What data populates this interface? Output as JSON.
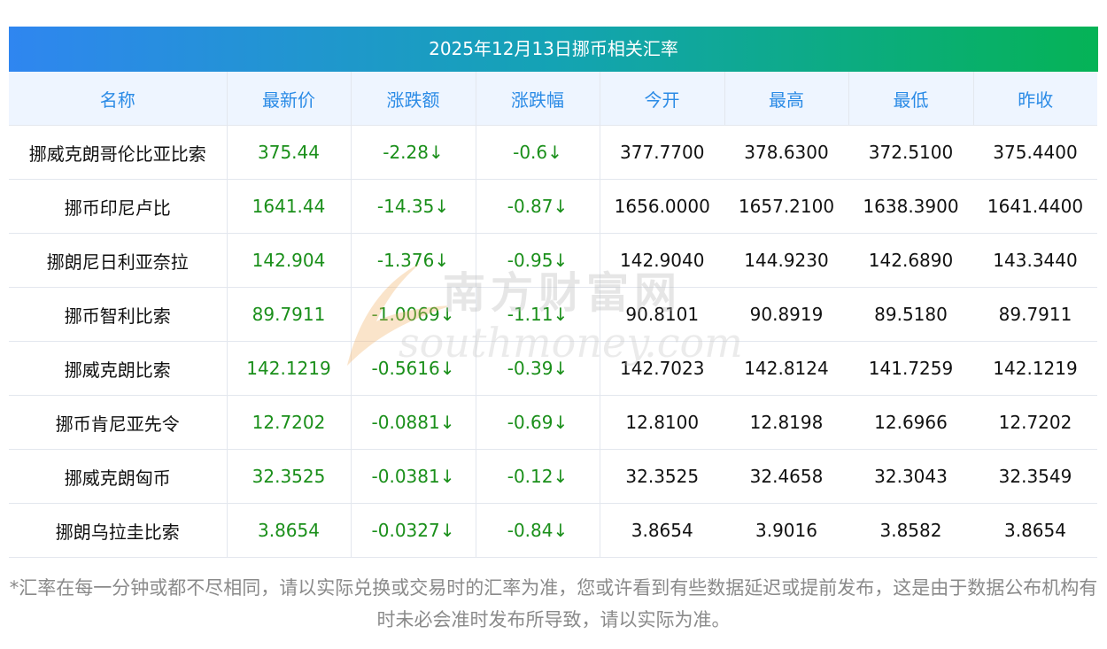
{
  "title": "2025年12月13日挪币相关汇率",
  "headers": [
    "名称",
    "最新价",
    "涨跌额",
    "涨跌幅",
    "今开",
    "最高",
    "最低",
    "昨收"
  ],
  "rows": [
    [
      "挪威克朗哥伦比亚比索",
      "375.44",
      "-2.28↓",
      "-0.6↓",
      "377.7700",
      "378.6300",
      "372.5100",
      "375.4400"
    ],
    [
      "挪币印尼卢比",
      "1641.44",
      "-14.35↓",
      "-0.87↓",
      "1656.0000",
      "1657.2100",
      "1638.3900",
      "1641.4400"
    ],
    [
      "挪朗尼日利亚奈拉",
      "142.904",
      "-1.376↓",
      "-0.95↓",
      "142.9040",
      "144.9230",
      "142.6890",
      "143.3440"
    ],
    [
      "挪币智利比索",
      "89.7911",
      "-1.0069↓",
      "-1.11↓",
      "90.8101",
      "90.8919",
      "89.5180",
      "89.7911"
    ],
    [
      "挪威克朗比索",
      "142.1219",
      "-0.5616↓",
      "-0.39↓",
      "142.7023",
      "142.8124",
      "141.7259",
      "142.1219"
    ],
    [
      "挪币肯尼亚先令",
      "12.7202",
      "-0.0881↓",
      "-0.69↓",
      "12.8100",
      "12.8198",
      "12.6966",
      "12.7202"
    ],
    [
      "挪威克朗匈币",
      "32.3525",
      "-0.0381↓",
      "-0.12↓",
      "32.3525",
      "32.4658",
      "32.3043",
      "32.3549"
    ],
    [
      "挪朗乌拉圭比索",
      "3.8654",
      "-0.0327↓",
      "-0.84↓",
      "3.8654",
      "3.9016",
      "3.8582",
      "3.8654"
    ]
  ],
  "watermark": {
    "cn": "南方财富网",
    "en": "southmoney.com"
  },
  "footnote": "*汇率在每一分钟或都不尽相同，请以实际兑换或交易时的汇率为准，您或许看到有些数据延迟或提前发布，这是由于数据公布机构有时未必会准时发布所导致，请以实际为准。",
  "colors": {
    "header_text": "#2b8be6",
    "change_green": "#1a8f1a",
    "banner_start": "#2f86f0",
    "banner_end": "#05b356"
  }
}
